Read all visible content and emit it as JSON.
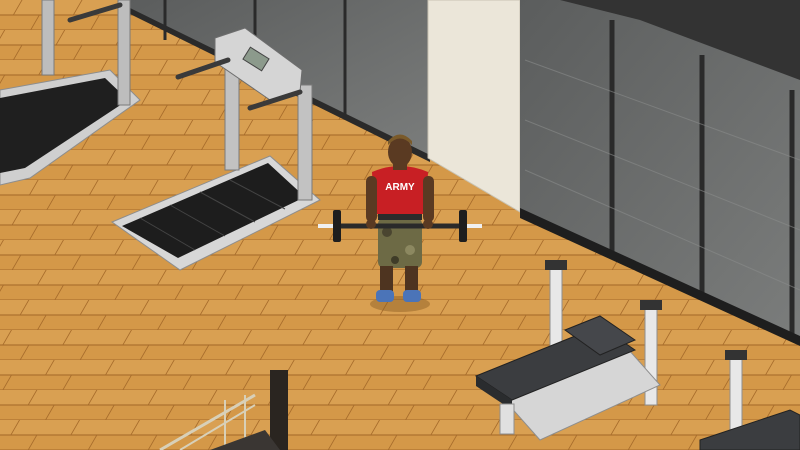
{
  "scene": {
    "shirt_text": "ARMY"
  },
  "colors": {
    "floor_light": "#d69a4c",
    "floor_dark": "#b97a31",
    "floor_line": "#9c6226",
    "glass": "#6c6e6e",
    "glass_dark": "#3f4141",
    "wall_frame": "#2a2a2a",
    "pillar": "#ece8dc",
    "equipment_metal": "#c9c9c9",
    "belt_black": "#1f1f1f",
    "bench_pad": "#3b3d40",
    "shirt_red": "#c81f24",
    "pants_camo": "#6d6a45",
    "skin": "#5a3a22",
    "shoes": "#4b74b8"
  }
}
